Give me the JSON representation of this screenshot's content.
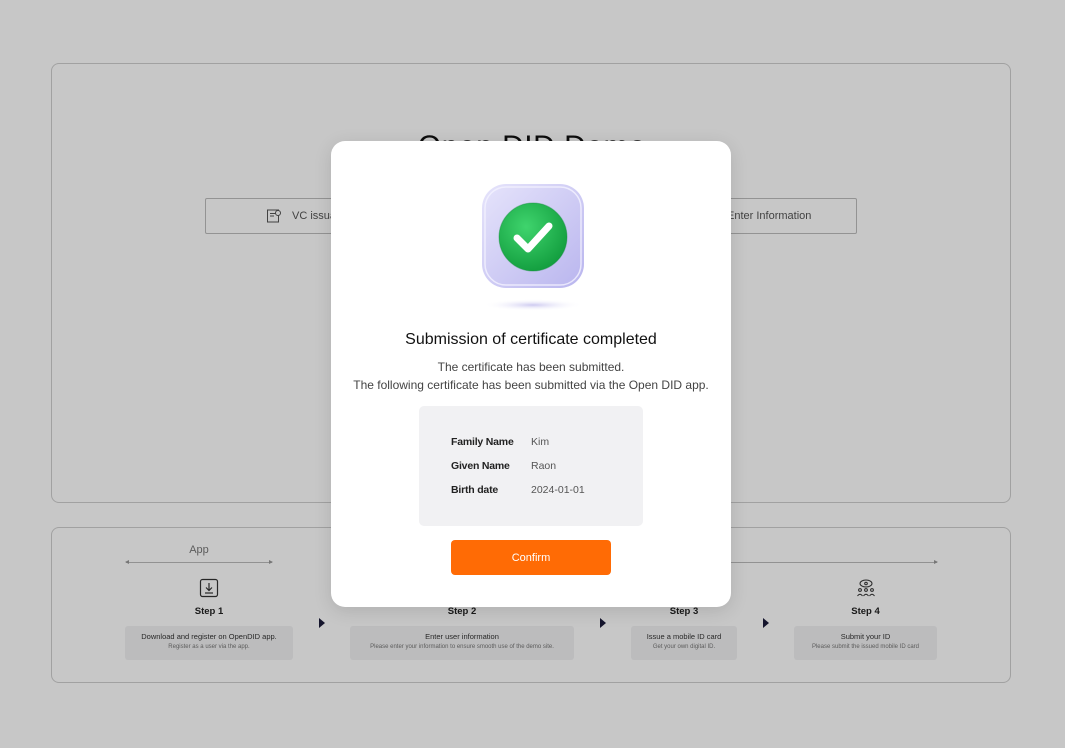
{
  "page": {
    "title": "Open DID Demo",
    "mode_left_label": "VC issuance",
    "mode_right_label": "Enter Information",
    "mode_icon": "certificate-icon"
  },
  "steps_panel": {
    "app_label": "App",
    "steps": [
      {
        "icon": "download-box-icon",
        "title": "Step 1",
        "desc": "Download and register on OpenDID app.",
        "sub": "Register as a user via the app."
      },
      {
        "icon": "user-form-icon",
        "title": "Step 2",
        "desc": "Enter user information",
        "sub": "Please enter your information to ensure smooth use of the demo site."
      },
      {
        "icon": "id-card-icon",
        "title": "Step 3",
        "desc": "Issue a mobile ID card",
        "sub": "Get your own digital ID."
      },
      {
        "icon": "people-network-icon",
        "title": "Step 4",
        "desc": "Submit your ID",
        "sub": "Please submit the issued mobile ID card"
      }
    ]
  },
  "modal": {
    "icon": "check-badge-icon",
    "title": "Submission of certificate completed",
    "line1": "The certificate has been submitted.",
    "line2": "The following certificate has been submitted via the Open DID app.",
    "fields": [
      {
        "label": "Family Name",
        "value": "Kim"
      },
      {
        "label": "Given Name",
        "value": "Raon"
      },
      {
        "label": "Birth date",
        "value": "2024-01-01"
      }
    ],
    "confirm_label": "Confirm"
  },
  "colors": {
    "accent": "#ff6b05",
    "success_green": "#21b04b",
    "icon_lavender": "#c9c6f2",
    "overlay": "rgba(0,0,0,0.22)"
  }
}
